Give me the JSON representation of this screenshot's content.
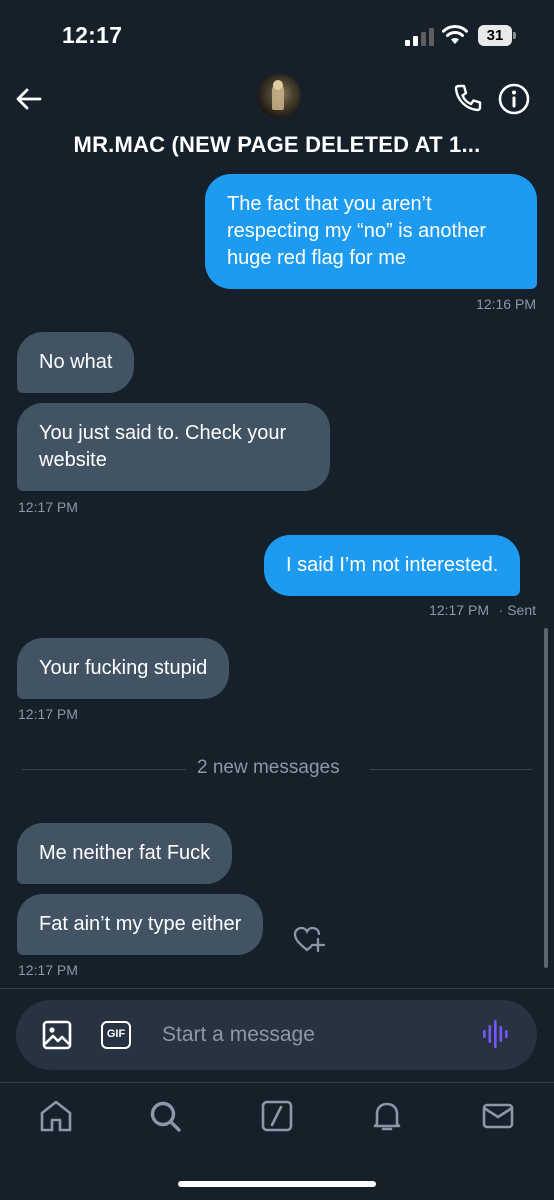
{
  "status_bar": {
    "time": "12:17",
    "battery_level": "31"
  },
  "header": {
    "title": "MR.MAC (NEW PAGE DELETED AT 1...",
    "back_icon": "arrow-left-icon",
    "call_icon": "phone-icon",
    "info_icon": "info-icon"
  },
  "messages": [
    {
      "direction": "sent",
      "text": "The fact that you aren’t respecting my “no” is another huge red flag for me"
    },
    {
      "direction": "received",
      "text": "No what"
    },
    {
      "direction": "received",
      "text": "You just said to. Check your website"
    },
    {
      "direction": "sent",
      "text": "I said I’m not interested."
    },
    {
      "direction": "received",
      "text": "Your fucking stupid"
    },
    {
      "direction": "received",
      "text": "Me neither fat  Fuck"
    },
    {
      "direction": "received",
      "text": "Fat ain’t my type either"
    }
  ],
  "timestamps": {
    "t1": "12:16 PM",
    "t2": "12:17 PM",
    "t3": "12:17 PM",
    "t3_status": "· Sent",
    "t4": "12:17 PM",
    "t5": "12:17 PM"
  },
  "divider": {
    "label": "2 new messages"
  },
  "composer": {
    "placeholder": "Start a message",
    "gif_label": "GIF"
  },
  "tabbar": {
    "items": [
      "home-icon",
      "search-icon",
      "grok-icon",
      "bell-icon",
      "mail-icon"
    ]
  },
  "colors": {
    "background": "#15202b",
    "sent_bubble": "#1d9bf0",
    "received_bubble": "#425364",
    "muted_text": "#8b98a5",
    "voice_accent": "#7856ff"
  }
}
